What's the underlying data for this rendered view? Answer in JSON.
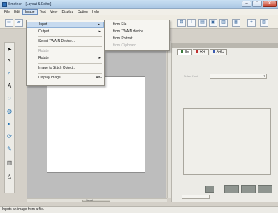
{
  "window": {
    "title": "Smother – [Layout & Editor]",
    "controls": {
      "minimize": "–",
      "maximize": "□",
      "close": "✕"
    }
  },
  "menubar": {
    "items": [
      "File",
      "Edit",
      "Image",
      "Text",
      "View",
      "Display",
      "Option",
      "Help"
    ],
    "active": "Image"
  },
  "image_menu": {
    "items": [
      {
        "label": "Input",
        "submenu": true
      },
      {
        "label": "Output",
        "submenu": true
      },
      {
        "label": "Select TWAIN Device..."
      },
      {
        "label": "Rotate",
        "disabled": true
      },
      {
        "label": "Rotate",
        "submenu": true
      },
      {
        "label": "Image to Stitch Object..."
      },
      {
        "label": "Display Image",
        "shortcut": "Alt+"
      }
    ]
  },
  "input_submenu": {
    "items": [
      {
        "label": "from File..."
      },
      {
        "label": "from TWAIN device..."
      },
      {
        "label": "from Portrait..."
      },
      {
        "label": "from Clipboard",
        "disabled": true
      }
    ]
  },
  "right_panel": {
    "tabs": [
      "TE",
      "RR",
      "ARC"
    ],
    "field_label": "Select Font",
    "combo_value": ""
  },
  "canvas": {
    "scroll_label": "Scroll"
  },
  "status": {
    "text": "Inputs an image from a file."
  },
  "colors": {
    "menu_highlight": "#c7daef",
    "canvas_bg": "#bdbdbd",
    "tool_blue": "#1f6fb0"
  }
}
